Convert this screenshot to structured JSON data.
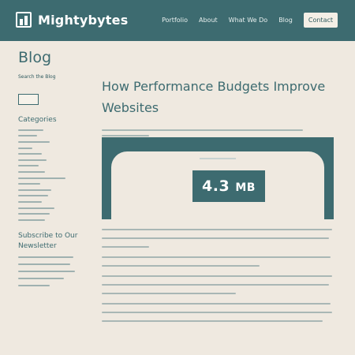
{
  "header": {
    "brand": "Mightybytes",
    "nav": [
      "Portfolio",
      "About",
      "What We Do",
      "Blog"
    ],
    "contact_label": "Contact",
    "colors": {
      "bar": "#3d6b70",
      "background": "#efe9e0"
    }
  },
  "sidebar": {
    "title": "Blog",
    "search_label": "Search the Blog",
    "categories_heading": "Categories",
    "subscribe_heading": "Subscribe to Our Newsletter"
  },
  "post": {
    "title": "How Performance Budgets Improve Websites",
    "hero_value": "4.3",
    "hero_unit": "MB"
  }
}
